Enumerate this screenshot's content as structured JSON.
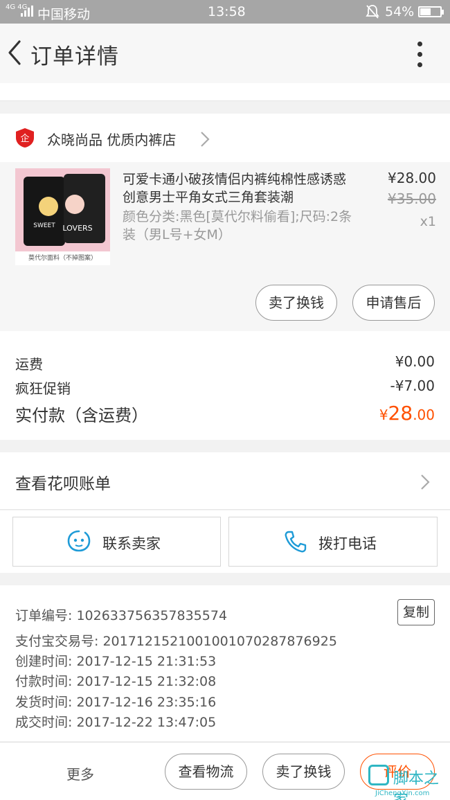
{
  "status_bar": {
    "signal_label": "4G 4G",
    "carrier": "中国移动",
    "time": "13:58",
    "battery": "54%",
    "battery_level": 0.54
  },
  "header": {
    "title": "订单详情"
  },
  "shop": {
    "name": "众晓尚品 优质内裤店"
  },
  "product": {
    "title": "可爱卡通小破孩情侣内裤纯棉性感诱惑创意男士平角女式三角套装潮",
    "spec": "颜色分类:黑色[莫代尔料偷看];尺码:2条装（男L号+女M）",
    "price": "¥28.00",
    "original_price": "¥35.00",
    "quantity": "x1",
    "image_caption": "莫代尔面料（不掉图案）",
    "image_text_1": "SWEET",
    "image_text_2": "LOVERS",
    "actions": {
      "resell": "卖了换钱",
      "after_sale": "申请售后"
    }
  },
  "fees": {
    "shipping_label": "运费",
    "shipping_value": "¥0.00",
    "promo_label": "疯狂促销",
    "promo_value": "-¥7.00",
    "total_label": "实付款（含运费）",
    "total_symbol": "¥",
    "total_int": "28",
    "total_dec": ".00"
  },
  "huabei": {
    "label": "查看花呗账单"
  },
  "contact": {
    "seller": "联系卖家",
    "call": "拨打电话"
  },
  "order_info": {
    "order_no": "订单编号: 102633756357835574",
    "copy": "复制",
    "alipay_no": "支付宝交易号: 2017121521001001070287876925",
    "created": "创建时间: 2017-12-15 21:31:53",
    "paid": "付款时间: 2017-12-15 21:32:08",
    "shipped": "发货时间: 2017-12-16 23:35:16",
    "completed": "成交时间: 2017-12-22 13:47:05"
  },
  "bottom_bar": {
    "more": "更多",
    "logistics": "查看物流",
    "resell": "卖了换钱",
    "rate": "评价"
  },
  "watermark": {
    "text": "脚本之家",
    "url": "JiChengXin.com"
  },
  "colors": {
    "accent": "#ff5000",
    "link_blue": "#1e9bd7",
    "status_bar": "#a6a6a6"
  }
}
